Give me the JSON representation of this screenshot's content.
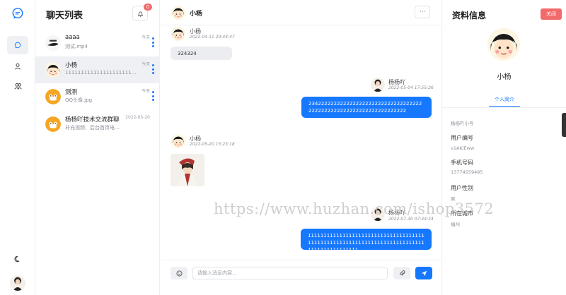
{
  "rail": {
    "logo_icon": "chat-bubble-icon",
    "nav": [
      {
        "icon": "message-icon",
        "active": true
      },
      {
        "icon": "user-icon",
        "active": false
      },
      {
        "icon": "group-icon",
        "active": false
      }
    ],
    "theme_icon": "moon-icon"
  },
  "chat_list": {
    "title": "聊天列表",
    "notification_count": "0",
    "items": [
      {
        "name": "aaaa",
        "preview": "测试.mp4",
        "time": "今天",
        "selected": false
      },
      {
        "name": "小杨",
        "preview": "111111111111111111111111111111111111",
        "time": "今天",
        "selected": true
      },
      {
        "name": "测测",
        "preview": "QQ头像.jpg",
        "time": "今天",
        "selected": false
      },
      {
        "name": "杨杨吖技术交流群聊",
        "preview": "补充视频：后台首页电...",
        "time": "2022-05-20",
        "selected": false
      }
    ]
  },
  "chat": {
    "header_name": "小杨",
    "more_label": "···",
    "messages": [
      {
        "sender": "小杨",
        "time": "2022-04-11 20:44:47",
        "text": "324324",
        "direction": "in"
      },
      {
        "sender": "杨杨吖",
        "time": "2022-05-04 17:55:26",
        "text": "2342222222222222222222222222222222222222222222222222222222222222222",
        "direction": "out"
      },
      {
        "sender": "小杨",
        "time": "2022-05-20 15:23:18",
        "text": "",
        "direction": "in",
        "kind": "image"
      },
      {
        "sender": "杨杨吖",
        "time": "2022-07-30 07:34:24",
        "text": "111111111111111111111111111111111111111111111111111111111111111111111111111111111111111111",
        "direction": "out"
      }
    ],
    "input_placeholder": "请输入消息内容..."
  },
  "profile": {
    "title": "资料信息",
    "close_label": "关闭",
    "name": "小杨",
    "tab": "个人简介",
    "nickname": "杨杨吖小号",
    "fields": [
      {
        "label": "用户编号",
        "value": "v1AKiEww"
      },
      {
        "label": "手机号码",
        "value": "13774559485"
      },
      {
        "label": "用户性别",
        "value": "男"
      },
      {
        "label": "所在城市",
        "value": "福州"
      }
    ]
  },
  "watermark": "https://www.huzhan.com/ishop3572",
  "colors": {
    "accent": "#1677ff",
    "danger": "#f26a6a",
    "incoming_bubble": "#ebedf0"
  }
}
